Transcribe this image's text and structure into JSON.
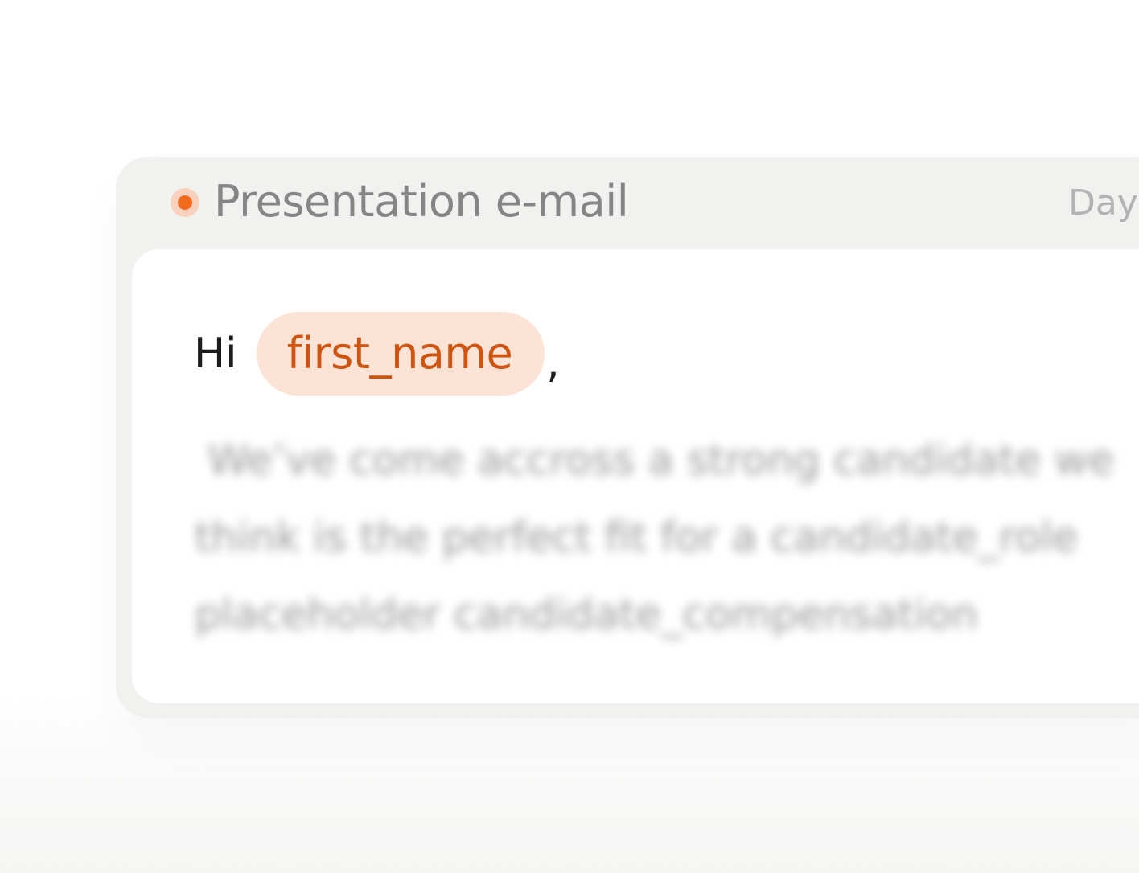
{
  "card": {
    "title": "Presentation e-mail",
    "day_label": "Day",
    "status_color": "#f26a1b",
    "status_icon": "status-dot-icon"
  },
  "message": {
    "greeting": "Hi",
    "variable": "first_name",
    "punctuation": ",",
    "blurred_lines": [
      "We’ve come accross a strong candidate we",
      "think is the perfect fit for a candidate_role",
      "placeholder candidate_compensation"
    ]
  }
}
